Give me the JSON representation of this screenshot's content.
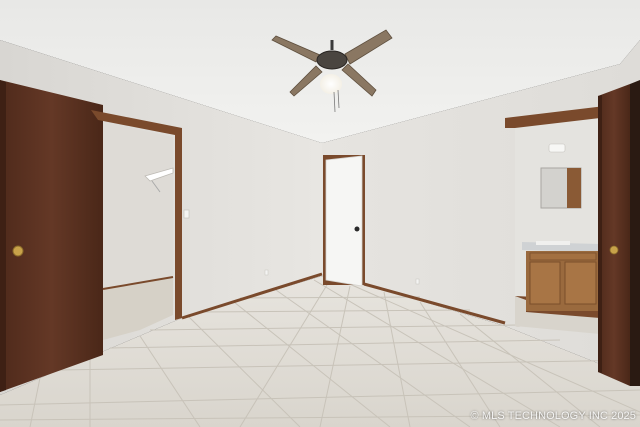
{
  "photo": {
    "alt": "Empty bedroom with ceiling fan, tile floor, walk-in closet and bathroom vanity",
    "watermark": "© MLS TECHNOLOGY INC 2025"
  },
  "colors": {
    "ceiling": "#ebebe8",
    "wall": "#e3e1dd",
    "wall_shadow": "#d2cfca",
    "floor": "#dedad2",
    "grout": "#c9c4ba",
    "door_wood": "#5c3322",
    "trim_wood": "#7a4a2c",
    "cabinet": "#9a6a3e"
  }
}
